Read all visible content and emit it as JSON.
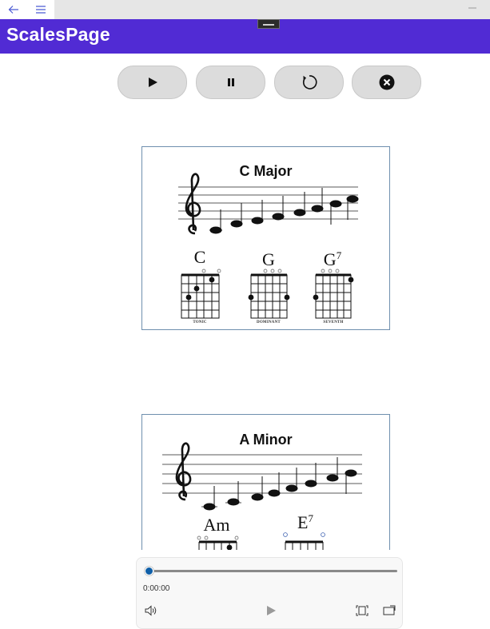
{
  "window": {
    "back_icon": "arrow-left-icon",
    "menu_icon": "hamburger-icon",
    "minimize_icon": "minimize-icon"
  },
  "header": {
    "title": "ScalesPage",
    "color": "#512bd4"
  },
  "controls": {
    "play_icon": "play-icon",
    "pause_icon": "pause-icon",
    "restart_icon": "restart-icon",
    "close_icon": "close-circle-icon"
  },
  "scales": [
    {
      "title": "C  Major",
      "chords": [
        {
          "name": "C",
          "sup": "",
          "role": "TONIC"
        },
        {
          "name": "G",
          "sup": "",
          "role": "DOMINANT"
        },
        {
          "name": "G",
          "sup": "7",
          "role": "SEVENTH"
        }
      ]
    },
    {
      "title": "A  Minor",
      "chords": [
        {
          "name": "Am",
          "sup": ""
        },
        {
          "name": "E",
          "sup": "7"
        }
      ]
    }
  ],
  "player": {
    "position": 0,
    "time": "0:00:00",
    "accent": "#0f5fa8",
    "volume_icon": "volume-icon",
    "play_icon": "play-icon",
    "fit_icon": "aspect-ratio-icon",
    "cast_icon": "cast-icon"
  }
}
